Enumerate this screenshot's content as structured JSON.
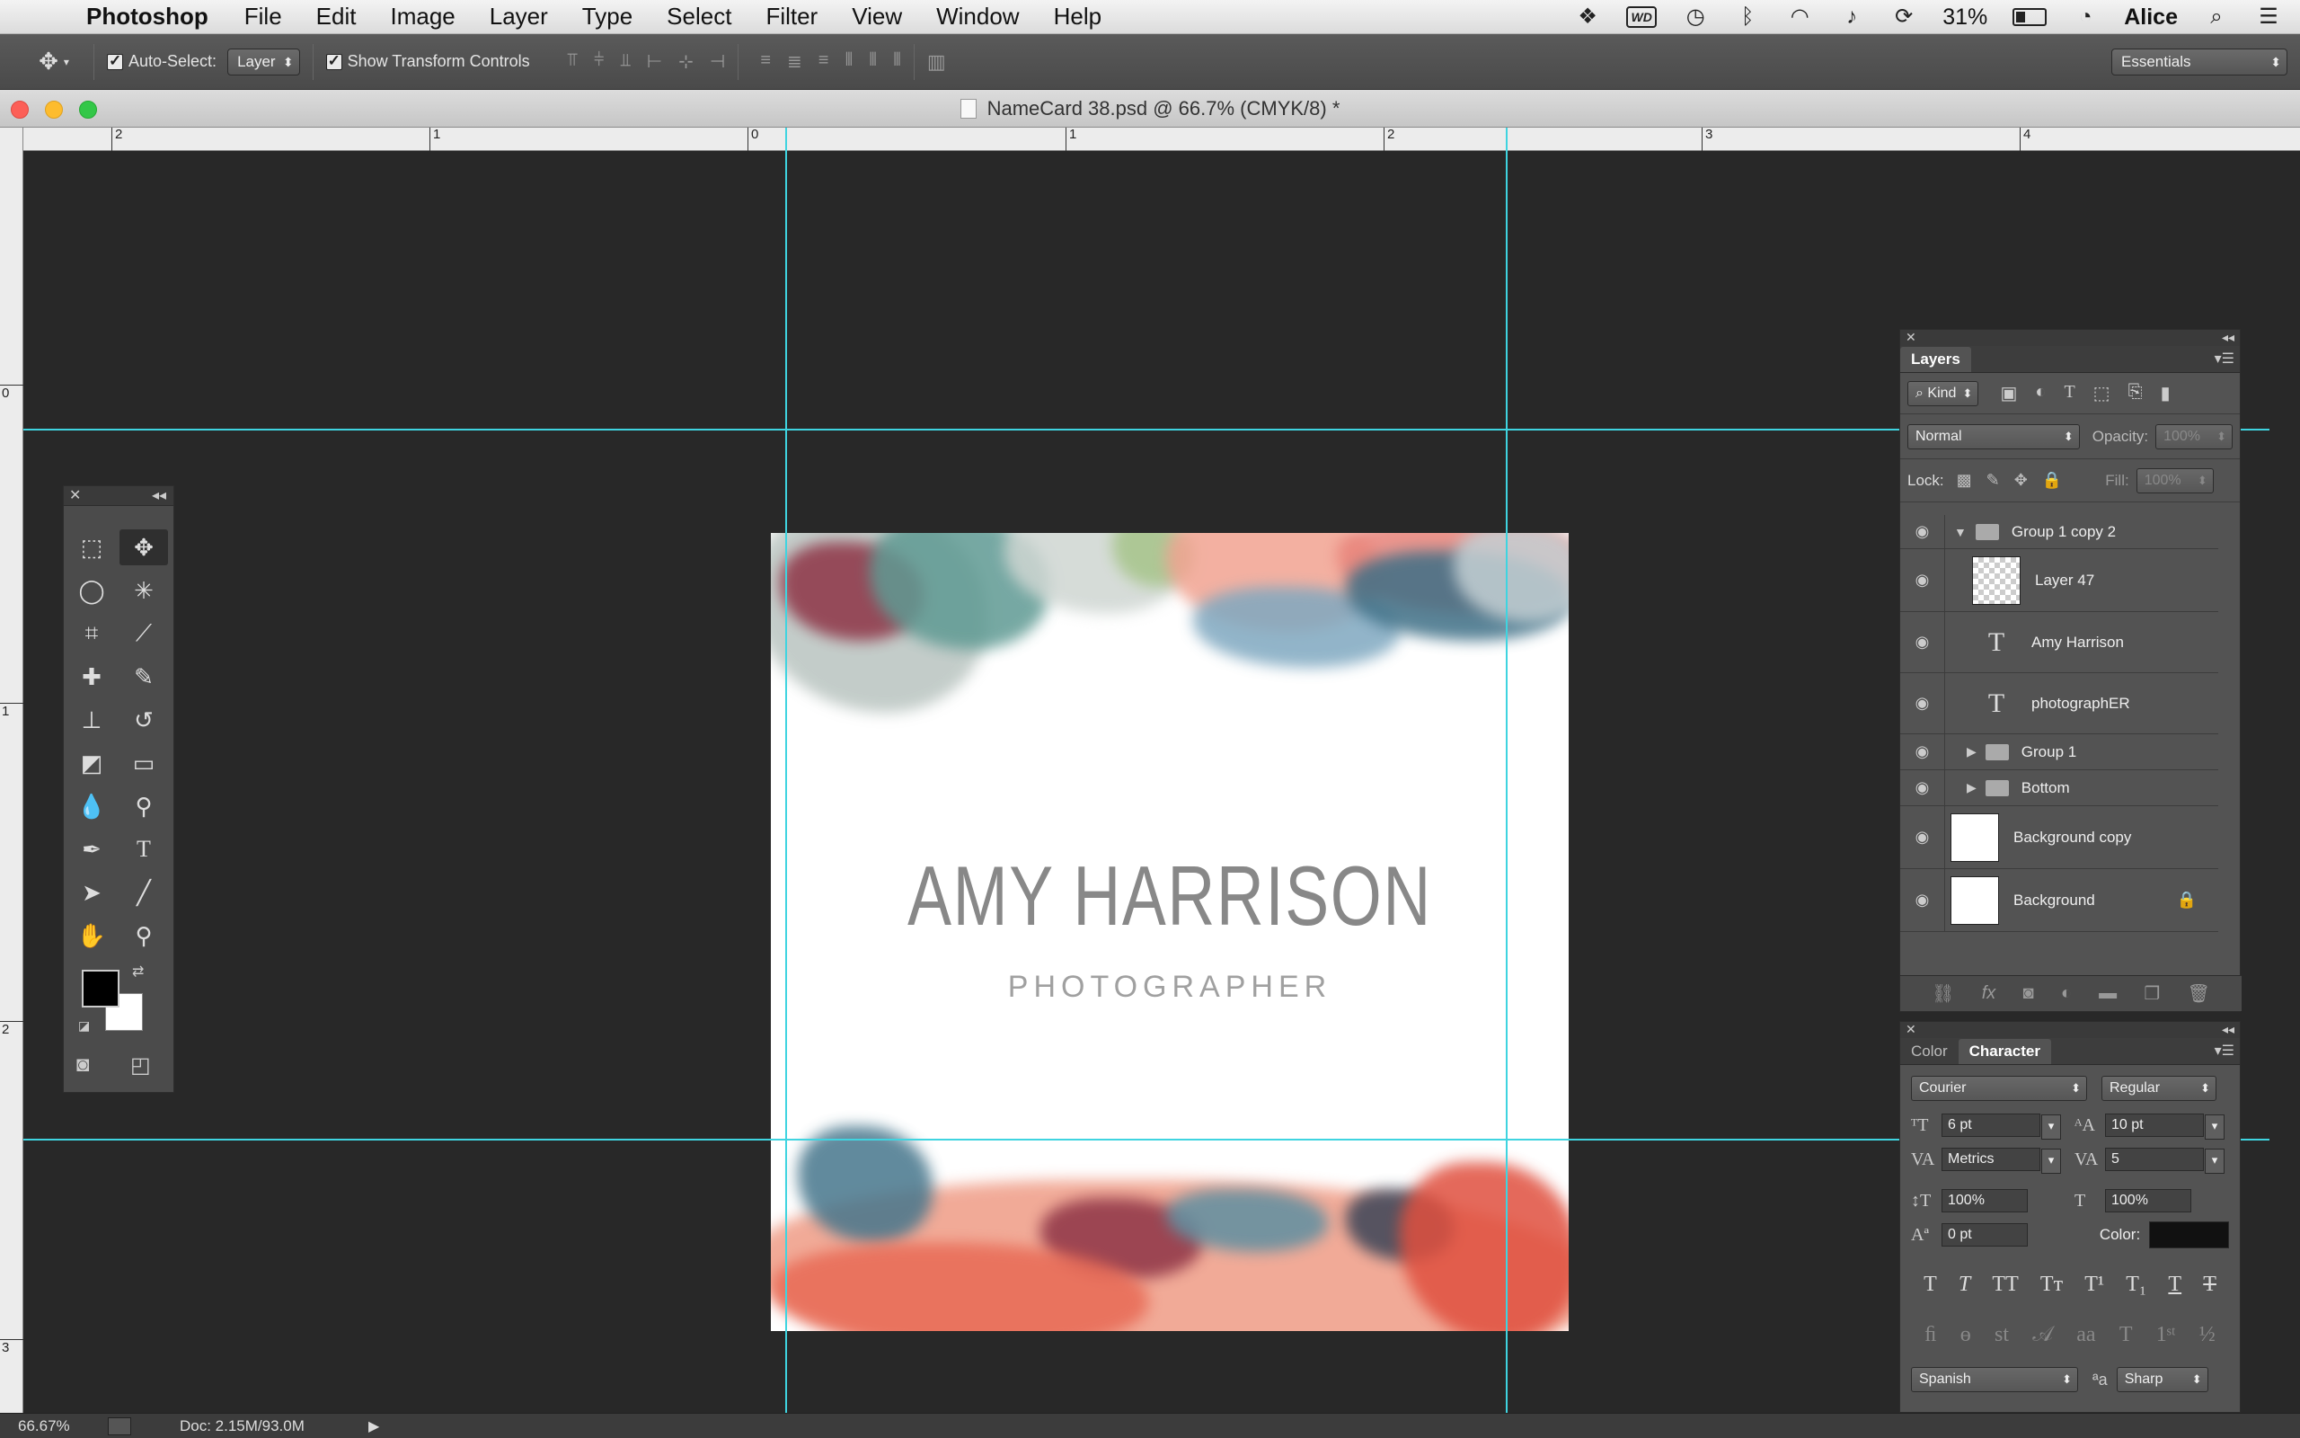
{
  "menubar": {
    "app_name": "Photoshop",
    "items": [
      "File",
      "Edit",
      "Image",
      "Layer",
      "Type",
      "Select",
      "Filter",
      "View",
      "Window",
      "Help"
    ],
    "battery": "31%",
    "user": "Alice",
    "wd_badge": "WD"
  },
  "options": {
    "auto_select_label": "Auto-Select:",
    "auto_select_value": "Layer",
    "show_transform_label": "Show Transform Controls",
    "workspace": "Essentials"
  },
  "document": {
    "title": "NameCard 38.psd @ 66.7% (CMYK/8) *"
  },
  "rulers": {
    "horizontal": [
      "2",
      "1",
      "0",
      "1",
      "2",
      "3",
      "4"
    ],
    "vertical": [
      "0",
      "1",
      "2",
      "3"
    ]
  },
  "card": {
    "name": "AMY HARRISON",
    "title": "PHOTOGRAPHER"
  },
  "layers_panel": {
    "tab": "Layers",
    "kind_label": "Kind",
    "blend_mode": "Normal",
    "opacity_label": "Opacity:",
    "opacity_value": "100%",
    "lock_label": "Lock:",
    "fill_label": "Fill:",
    "fill_value": "100%",
    "layers": [
      {
        "name": "Group 1 copy 2",
        "type": "group-open"
      },
      {
        "name": "Layer 47",
        "type": "pixel"
      },
      {
        "name": "Amy Harrison",
        "type": "text"
      },
      {
        "name": "photographER",
        "type": "text"
      },
      {
        "name": "Group 1",
        "type": "group"
      },
      {
        "name": "Bottom",
        "type": "group"
      },
      {
        "name": "Background copy",
        "type": "pixel"
      },
      {
        "name": "Background",
        "type": "pixel-locked"
      }
    ]
  },
  "character_panel": {
    "tabs": [
      "Color",
      "Character"
    ],
    "font_family": "Courier",
    "font_style": "Regular",
    "font_size": "6 pt",
    "leading": "10 pt",
    "kerning": "Metrics",
    "tracking": "5",
    "vertical_scale": "100%",
    "horizontal_scale": "100%",
    "baseline_shift": "0 pt",
    "color_label": "Color:",
    "language": "Spanish",
    "antialias": "Sharp",
    "antialias_icon": "ªa",
    "color_value": "#111111"
  },
  "status": {
    "zoom": "66.67%",
    "doc": "Doc: 2.15M/93.0M"
  }
}
